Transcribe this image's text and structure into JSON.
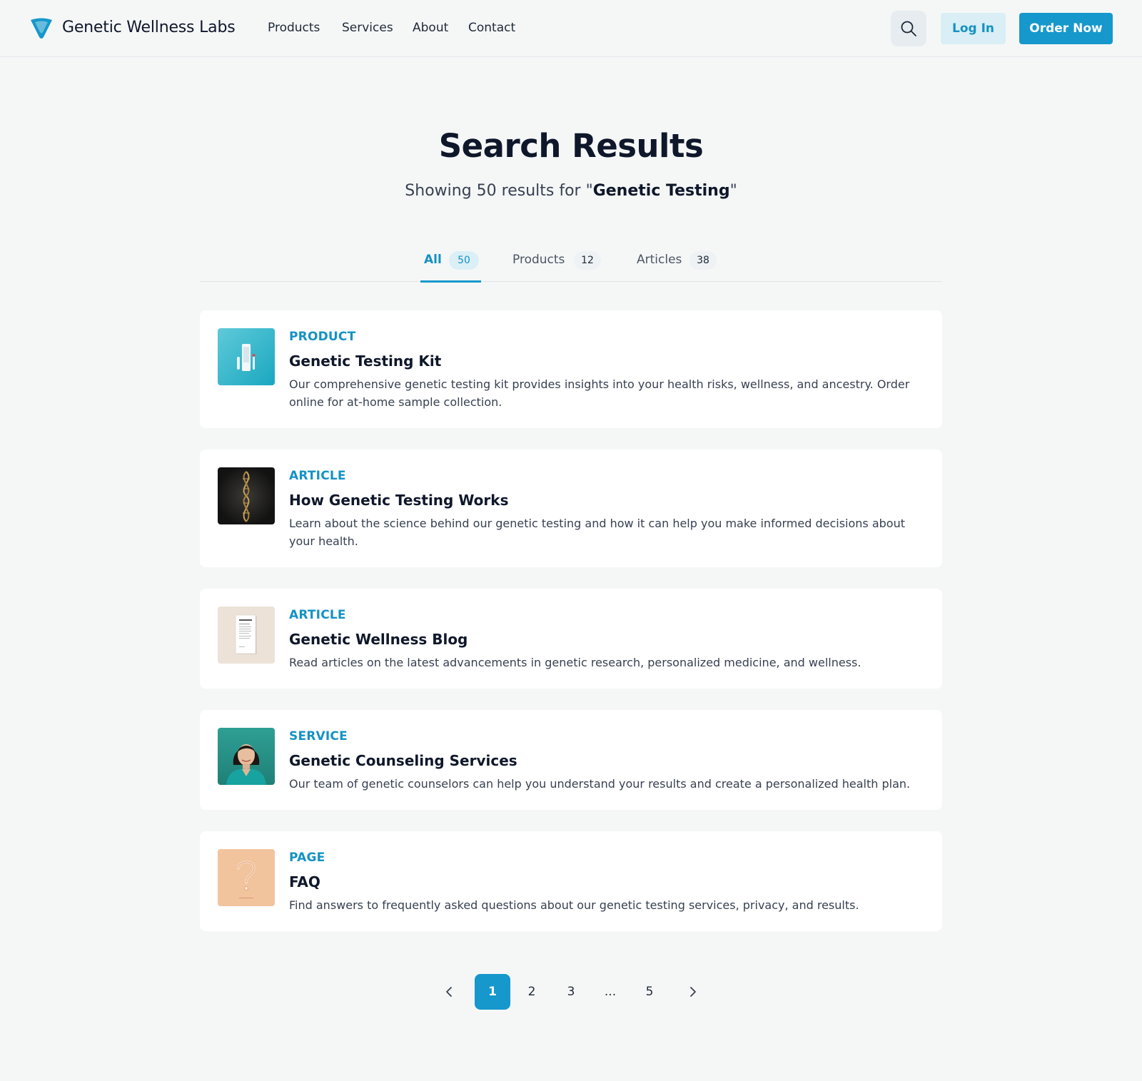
{
  "header": {
    "brand": "Genetic Wellness Labs",
    "nav": [
      "Products",
      "Services",
      "About",
      "Contact"
    ],
    "login_label": "Log In",
    "order_label": "Order Now",
    "logo_icon": "funnel-logo-icon",
    "search_icon": "search-icon"
  },
  "main": {
    "title": "Search Results",
    "subtitle_prefix": "Showing 50 results for \"",
    "query": "Genetic Testing",
    "subtitle_suffix": "\""
  },
  "tabs": [
    {
      "label": "All",
      "count": "50",
      "active": true
    },
    {
      "label": "Products",
      "count": "12",
      "active": false
    },
    {
      "label": "Articles",
      "count": "38",
      "active": false
    }
  ],
  "results": [
    {
      "type": "PRODUCT",
      "title": "Genetic Testing Kit",
      "desc": "Our comprehensive genetic testing kit provides insights into your health risks, wellness, and ancestry. Order online for at-home sample collection.",
      "thumb": "test-kit-image"
    },
    {
      "type": "ARTICLE",
      "title": "How Genetic Testing Works",
      "desc": "Learn about the science behind our genetic testing and how it can help you make informed decisions about your health.",
      "thumb": "dna-helix-image"
    },
    {
      "type": "ARTICLE",
      "title": "Genetic Wellness Blog",
      "desc": "Read articles on the latest advancements in genetic research, personalized medicine, and wellness.",
      "thumb": "blog-page-image"
    },
    {
      "type": "SERVICE",
      "title": "Genetic Counseling Services",
      "desc": "Our team of genetic counselors can help you understand your results and create a personalized health plan.",
      "thumb": "counselor-photo"
    },
    {
      "type": "PAGE",
      "title": "FAQ",
      "desc": "Find answers to frequently asked questions about our genetic testing services, privacy, and results.",
      "thumb": "question-mark-image"
    }
  ],
  "pagination": {
    "pages": [
      "1",
      "2",
      "3",
      "...",
      "5"
    ],
    "current": "1"
  },
  "colors": {
    "accent": "#1698cc",
    "background": "#f5f7f7",
    "text": "#0f172a"
  }
}
